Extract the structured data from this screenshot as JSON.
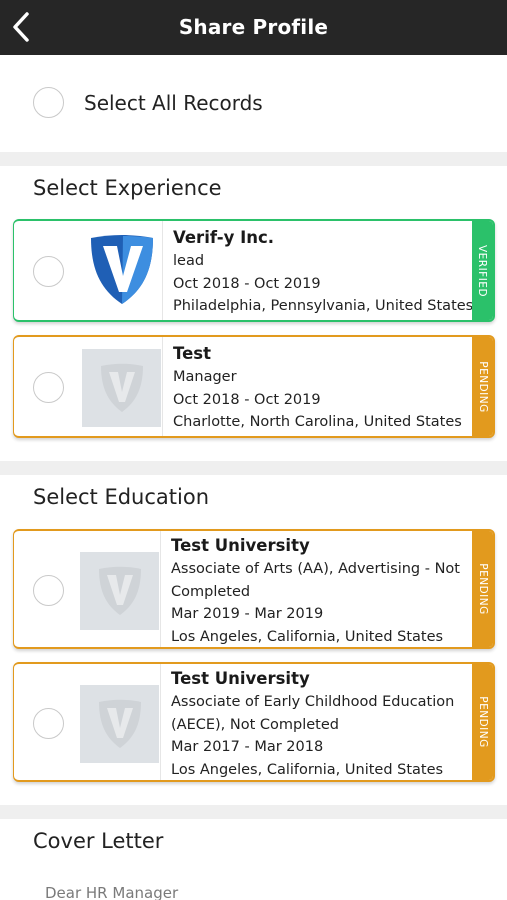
{
  "header": {
    "title": "Share Profile",
    "back_icon": "chevron-left-icon"
  },
  "select_all": {
    "label": "Select All Records"
  },
  "experience": {
    "title": "Select Experience",
    "items": [
      {
        "company": "Verif-y Inc.",
        "role": "lead",
        "dates": "Oct 2018 - Oct 2019",
        "location": "Philadelphia, Pennsylvania, United States",
        "status": "VERIFIED",
        "status_color": "#2bc16a",
        "logo": "verif-y-logo"
      },
      {
        "company": "Test",
        "role": "Manager",
        "dates": "Oct 2018 - Oct 2019",
        "location": "Charlotte, North Carolina, United States",
        "status": "PENDING",
        "status_color": "#e29a1e",
        "logo": "placeholder-logo"
      }
    ]
  },
  "education": {
    "title": "Select Education",
    "items": [
      {
        "school": "Test University",
        "degree_line1": "Associate of Arts (AA),  Advertising - Not",
        "degree_line2": "Completed",
        "dates": "Mar 2019 - Mar 2019",
        "location": "Los Angeles, California, United States",
        "status": "PENDING",
        "status_color": "#e29a1e",
        "logo": "placeholder-logo"
      },
      {
        "school": "Test University",
        "degree_line1": "Associate of Early Childhood Education",
        "degree_line2": "(AECE),  Not Completed",
        "dates": "Mar 2017 - Mar 2018",
        "location": "Los Angeles, California, United States",
        "status": "PENDING",
        "status_color": "#e29a1e",
        "logo": "placeholder-logo"
      }
    ]
  },
  "cover_letter": {
    "title": "Cover Letter",
    "value": "Dear HR Manager"
  },
  "colors": {
    "header_bg": "#262626",
    "verified": "#2bc16a",
    "pending": "#e29a1e",
    "separator": "#efefef"
  }
}
